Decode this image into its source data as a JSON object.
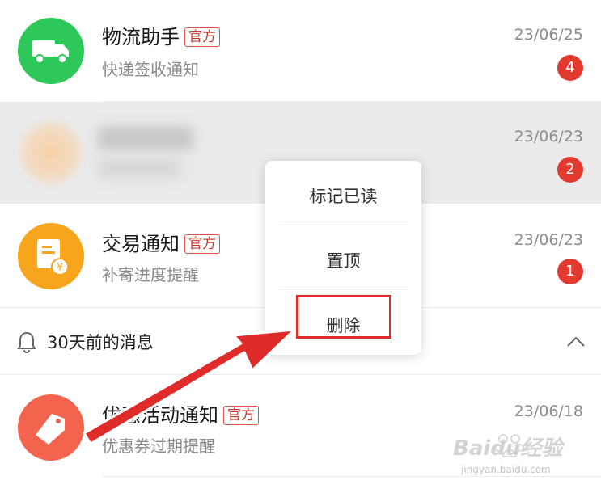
{
  "messages": [
    {
      "title": "物流助手",
      "tag": "官方",
      "subtitle": "快递签收通知",
      "date": "23/06/25",
      "badge": "4",
      "icon": "truck-icon",
      "color": "#2ec85a"
    },
    {
      "title": "",
      "tag": "",
      "subtitle": "",
      "date": "23/06/23",
      "badge": "2",
      "icon": "blurred-avatar",
      "color": "#f6c9a0"
    },
    {
      "title": "交易通知",
      "tag": "官方",
      "subtitle": "补寄进度提醒",
      "date": "23/06/23",
      "badge": "1",
      "icon": "receipt-yen-icon",
      "color": "#f7a51c"
    },
    {
      "title": "优惠活动通知",
      "tag": "官方",
      "subtitle": "优惠券过期提醒",
      "date": "23/06/18",
      "badge": "",
      "icon": "coupon-tag-icon",
      "color": "#f2644e"
    }
  ],
  "section": {
    "label": "30天前的消息",
    "icon": "bell-icon",
    "toggle_icon": "chevron-up-icon"
  },
  "context_menu": {
    "items": [
      "标记已读",
      "置顶",
      "删除"
    ],
    "highlighted": "删除"
  },
  "watermark": {
    "brand": "Baidu经验",
    "url": "jingyan.baidu.com"
  },
  "colors": {
    "badge": "#e33a2f",
    "tag": "#d03a30",
    "highlight": "#e02b2b",
    "arrow": "#e02b2b"
  }
}
